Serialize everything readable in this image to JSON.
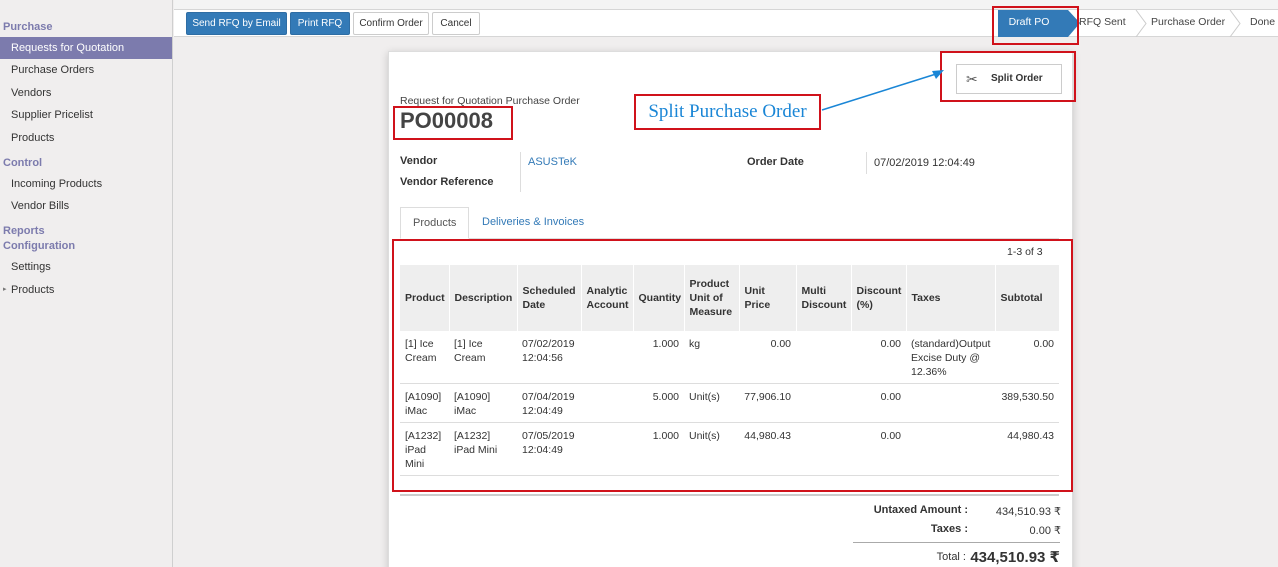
{
  "sidebar": {
    "sections": [
      {
        "title": "Purchase",
        "items": [
          "Requests for Quotation",
          "Purchase Orders",
          "Vendors",
          "Supplier Pricelist",
          "Products"
        ]
      },
      {
        "title": "Control",
        "items": [
          "Incoming Products",
          "Vendor Bills"
        ]
      },
      {
        "title": "Reports",
        "items": []
      },
      {
        "title": "Configuration",
        "items": [
          "Settings",
          "Products"
        ]
      }
    ],
    "active_item": "Requests for Quotation"
  },
  "toolbar": {
    "send_rfq_email": "Send RFQ by Email",
    "print_rfq": "Print RFQ",
    "confirm_order": "Confirm Order",
    "cancel": "Cancel"
  },
  "statusbar": {
    "stages": [
      "Draft PO",
      "RFQ Sent",
      "Purchase Order",
      "Done"
    ],
    "current": "Draft PO"
  },
  "form": {
    "doc_type": "Request for Quotation Purchase Order",
    "name": "PO00008",
    "split_button": "Split Order",
    "vendor_label": "Vendor",
    "vendor_value": "ASUSTeK",
    "vendor_ref_label": "Vendor Reference",
    "vendor_ref_value": "",
    "order_date_label": "Order Date",
    "order_date_value": "07/02/2019 12:04:49",
    "tabs": [
      "Products",
      "Deliveries & Invoices"
    ],
    "active_tab": "Products",
    "pager": "1-3 of 3"
  },
  "annotation": {
    "text": "Split Purchase Order",
    "color": "#1a86d6",
    "highlight_color": "#d0121b"
  },
  "table": {
    "headers": [
      "Product",
      "Description",
      "Scheduled Date",
      "Analytic Account",
      "Quantity",
      "Product Unit of Measure",
      "Unit Price",
      "Multi Discount",
      "Discount (%)",
      "Taxes",
      "Subtotal"
    ],
    "rows": [
      [
        "[1] Ice Cream",
        "[1] Ice Cream",
        "07/02/2019 12:04:56",
        "",
        "1.000",
        "kg",
        "0.00",
        "",
        "0.00",
        "(standard)Output Excise Duty @ 12.36%",
        "0.00"
      ],
      [
        "[A1090] iMac",
        "[A1090] iMac",
        "07/04/2019 12:04:49",
        "",
        "5.000",
        "Unit(s)",
        "77,906.10",
        "",
        "0.00",
        "",
        "389,530.50"
      ],
      [
        "[A1232] iPad Mini",
        "[A1232] iPad Mini",
        "07/05/2019 12:04:49",
        "",
        "1.000",
        "Unit(s)",
        "44,980.43",
        "",
        "0.00",
        "",
        "44,980.43"
      ]
    ]
  },
  "totals": {
    "untaxed_label": "Untaxed Amount :",
    "untaxed_value": "434,510.93 ₹",
    "taxes_label": "Taxes :",
    "taxes_value": "0.00 ₹",
    "total_label": "Total :",
    "total_value": "434,510.93 ₹"
  },
  "colors": {
    "primary": "#337ab7",
    "sidebar_active": "#7c7bad"
  }
}
